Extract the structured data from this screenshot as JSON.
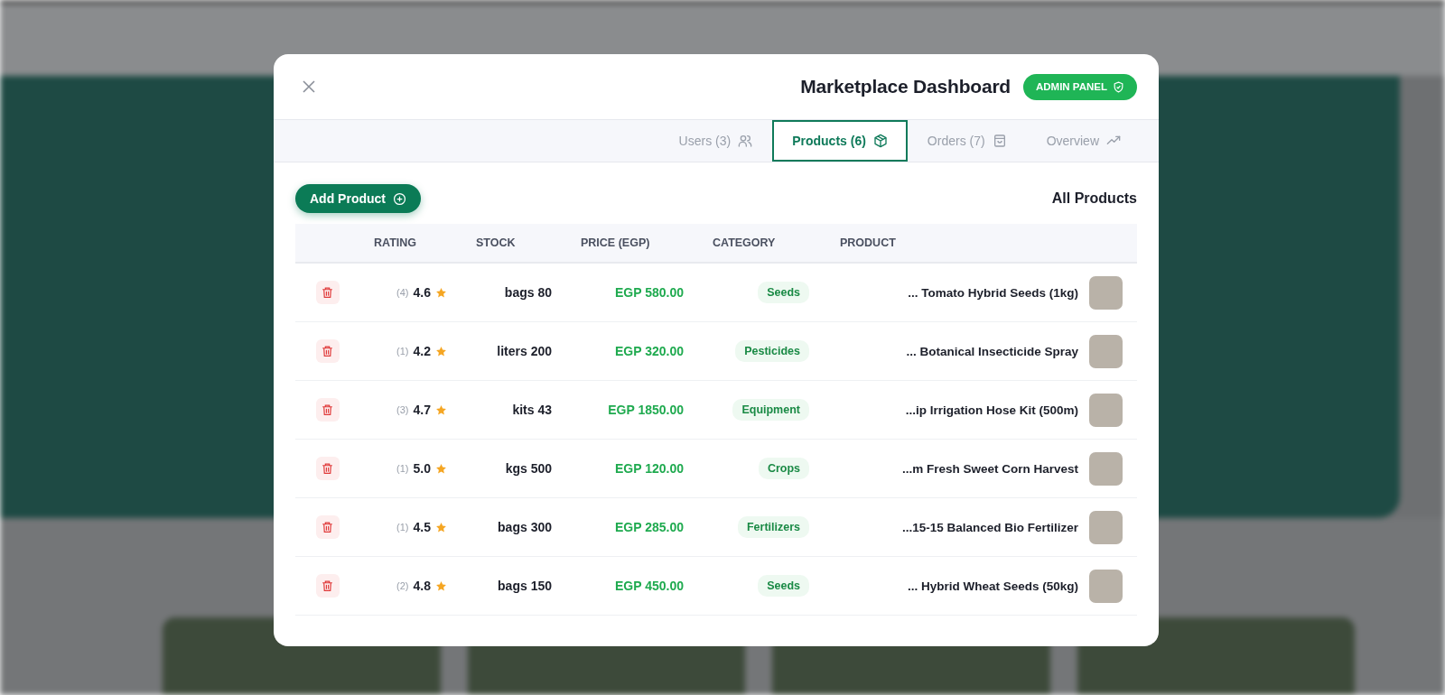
{
  "dialog": {
    "title": "Marketplace Dashboard",
    "badge": "ADMIN PANEL"
  },
  "tabs": [
    {
      "label": "Users (3)",
      "selected": false
    },
    {
      "label": "Products (6)",
      "selected": true
    },
    {
      "label": "Orders (7)",
      "selected": false
    },
    {
      "label": "Overview",
      "selected": false
    }
  ],
  "add_button": "Add Product",
  "section_title": "All Products",
  "table": {
    "columns": [
      "RATING",
      "STOCK",
      "PRICE (EGP)",
      "CATEGORY",
      "PRODUCT"
    ],
    "rows": [
      {
        "rating_count": "(4)",
        "rating": "4.6",
        "stock": "bags 80",
        "price": "EGP 580.00",
        "category": "Seeds",
        "product": "... Tomato Hybrid Seeds (1kg)"
      },
      {
        "rating_count": "(1)",
        "rating": "4.2",
        "stock": "liters 200",
        "price": "EGP 320.00",
        "category": "Pesticides",
        "product": "... Botanical Insecticide Spray"
      },
      {
        "rating_count": "(3)",
        "rating": "4.7",
        "stock": "kits 43",
        "price": "EGP 1850.00",
        "category": "Equipment",
        "product": "...ip Irrigation Hose Kit (500m)"
      },
      {
        "rating_count": "(1)",
        "rating": "5.0",
        "stock": "kgs 500",
        "price": "EGP 120.00",
        "category": "Crops",
        "product": "...m Fresh Sweet Corn Harvest"
      },
      {
        "rating_count": "(1)",
        "rating": "4.5",
        "stock": "bags 300",
        "price": "EGP 285.00",
        "category": "Fertilizers",
        "product": "...15-15 Balanced Bio Fertilizer"
      },
      {
        "rating_count": "(2)",
        "rating": "4.8",
        "stock": "bags 150",
        "price": "EGP 450.00",
        "category": "Seeds",
        "product": "... Hybrid Wheat Seeds (50kg)"
      }
    ]
  }
}
